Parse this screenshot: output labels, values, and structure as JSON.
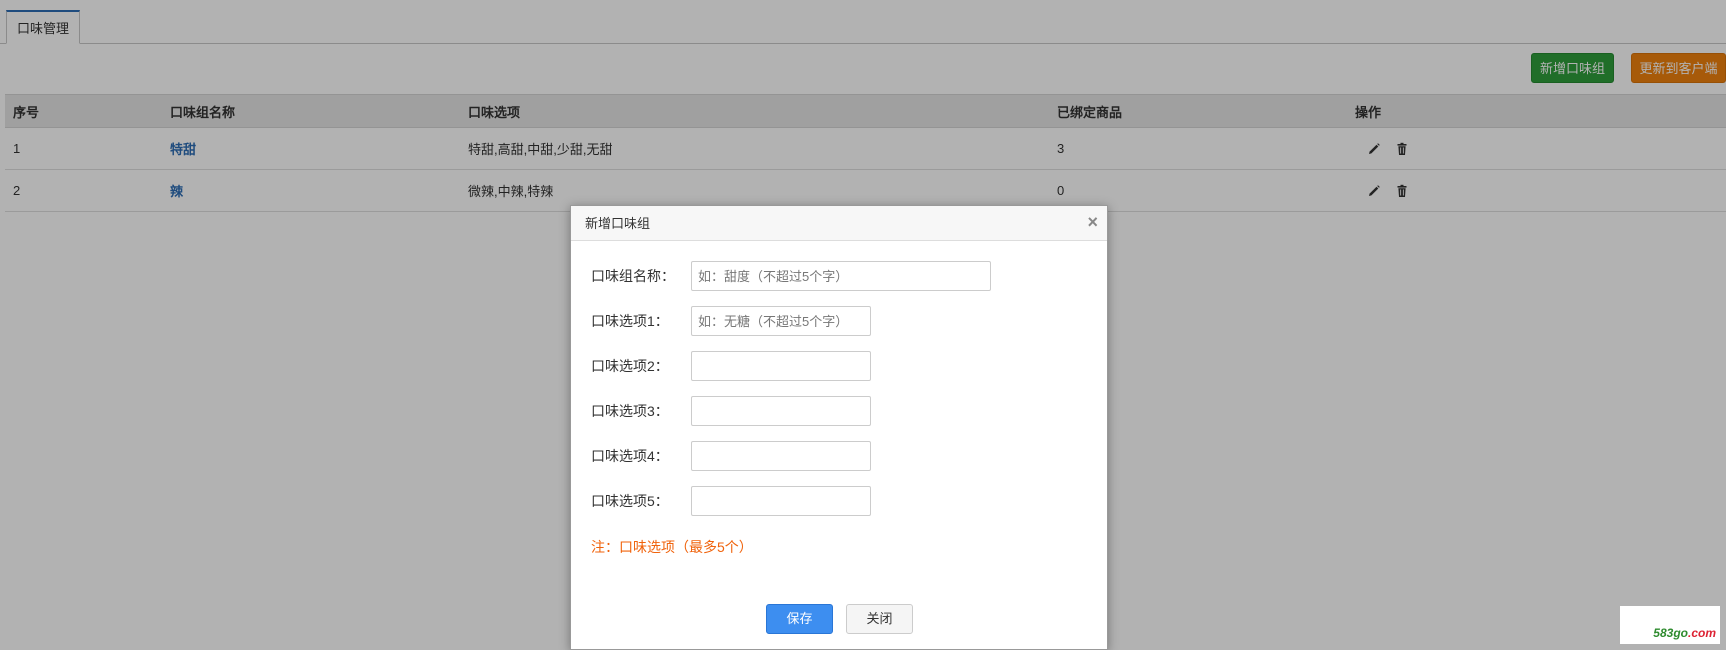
{
  "tabs": [
    {
      "label": "口味管理",
      "active": true
    }
  ],
  "toolbar": {
    "add_label": "新增口味组",
    "update_label": "更新到客户端"
  },
  "table": {
    "headers": [
      "序号",
      "口味组名称",
      "口味选项",
      "已绑定商品",
      "操作"
    ],
    "rows": [
      {
        "index": "1",
        "name": "特甜",
        "options": "特甜,高甜,中甜,少甜,无甜",
        "bound": "3"
      },
      {
        "index": "2",
        "name": "辣",
        "options": "微辣,中辣,特辣",
        "bound": "0"
      }
    ]
  },
  "modal": {
    "title": "新增口味组",
    "fields": [
      {
        "label": "口味组名称：",
        "value": "",
        "placeholder": "如：甜度（不超过5个字）"
      },
      {
        "label": "口味选项1：",
        "value": "",
        "placeholder": "如：无糖（不超过5个字）"
      },
      {
        "label": "口味选项2：",
        "value": "",
        "placeholder": ""
      },
      {
        "label": "口味选项3：",
        "value": "",
        "placeholder": ""
      },
      {
        "label": "口味选项4：",
        "value": "",
        "placeholder": ""
      },
      {
        "label": "口味选项5：",
        "value": "",
        "placeholder": ""
      }
    ],
    "note": "注：口味选项（最多5个）",
    "save_label": "保存",
    "close_label": "关闭"
  },
  "icons": {
    "edit": "pencil-icon",
    "delete": "trash-icon",
    "close": "close-icon"
  },
  "colors": {
    "primary": "#2d6db5",
    "green": "#2e9e3b",
    "orange": "#f0820d",
    "note": "#f0630c",
    "save": "#3d8ef0"
  },
  "watermark": {
    "prefix": "583go",
    "suffix": ".com"
  }
}
